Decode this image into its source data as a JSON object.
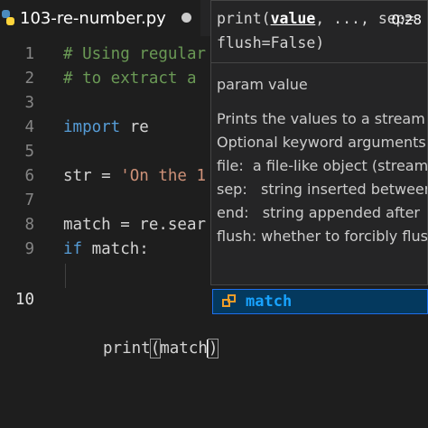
{
  "tab": {
    "title": "103-re-number.py",
    "icon": "python-file-icon"
  },
  "video_timer": "0:28",
  "lines": [
    {
      "num": "1",
      "parts": [
        {
          "t": "# Using regular",
          "c": "comment"
        }
      ]
    },
    {
      "num": "2",
      "parts": [
        {
          "t": "# to extract a",
          "c": "comment"
        }
      ]
    },
    {
      "num": "3",
      "parts": []
    },
    {
      "num": "4",
      "parts": [
        {
          "t": "import",
          "c": "kw"
        },
        {
          "t": " re",
          "c": "plain"
        }
      ]
    },
    {
      "num": "5",
      "parts": []
    },
    {
      "num": "6",
      "parts": [
        {
          "t": "str = ",
          "c": "plain"
        },
        {
          "t": "'On the 1",
          "c": "str"
        }
      ]
    },
    {
      "num": "7",
      "parts": []
    },
    {
      "num": "8",
      "parts": [
        {
          "t": "match = re.sear",
          "c": "plain"
        }
      ]
    },
    {
      "num": "9",
      "parts": [
        {
          "t": "if",
          "c": "kw"
        },
        {
          "t": " match:",
          "c": "plain"
        }
      ]
    },
    {
      "num": "10",
      "parts": []
    }
  ],
  "line10": {
    "before": "print",
    "open": "(",
    "arg": "match",
    "close": ")"
  },
  "hover": {
    "sig_prefix": "print(",
    "sig_param": "value",
    "sig_rest": ", ..., sep=",
    "sig_line2": "flush=False)",
    "param_title": "param value",
    "doc_lines": [
      "Prints the values to a stream",
      "Optional keyword arguments:",
      "file:  a file-like object (stream)",
      "sep:   string inserted between",
      "end:   string appended after",
      "flush: whether to forcibly flush"
    ]
  },
  "suggestion": {
    "label": "match",
    "icon": "variable-icon"
  }
}
